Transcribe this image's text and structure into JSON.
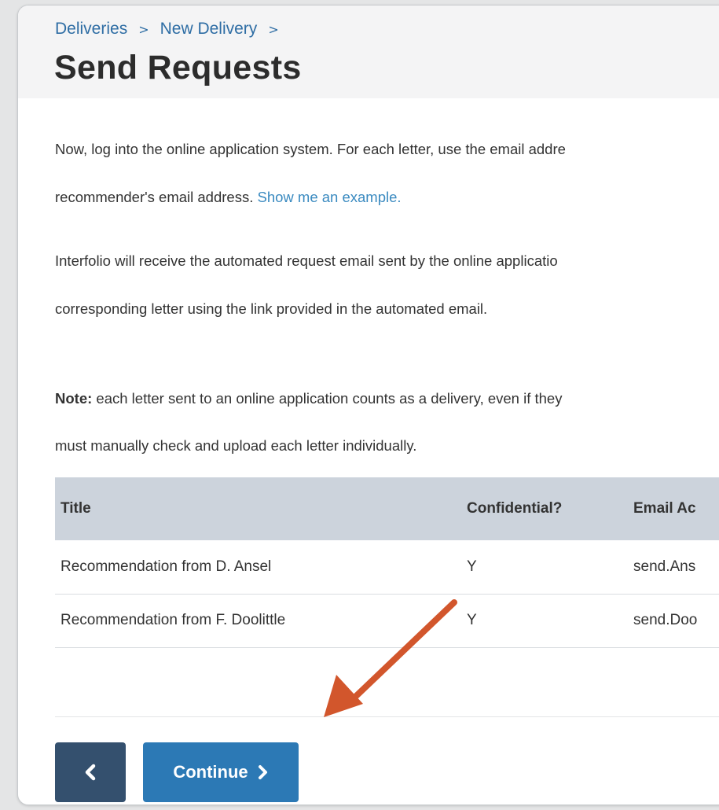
{
  "breadcrumb": {
    "items": [
      "Deliveries",
      "New Delivery"
    ],
    "separator": ">"
  },
  "page_title": "Send Requests",
  "instructions": {
    "p1_line1": "Now, log into the online application system. For each letter, use the email addre",
    "p1_line2_text": "recommender's email address. ",
    "p1_link": "Show me an example.",
    "p2_line1": "Interfolio will receive the automated request email sent by the online applicatio",
    "p2_line2": "corresponding letter using the link provided in the automated email.",
    "note_label": "Note:",
    "note_line1": " each letter sent to an online application counts as a delivery, even if they",
    "note_line2": "must manually check and upload each letter individually."
  },
  "table": {
    "columns": [
      "Title",
      "Confidential?",
      "Email Ac"
    ],
    "rows": [
      {
        "title": "Recommendation from D. Ansel",
        "confidential": "Y",
        "email": "send.Ans"
      },
      {
        "title": "Recommendation from F. Doolittle",
        "confidential": "Y",
        "email": "send.Doo"
      }
    ]
  },
  "buttons": {
    "back_icon": "chevron-left-icon",
    "continue_label": "Continue",
    "continue_icon": "chevron-right-icon"
  },
  "colors": {
    "link": "#2e6da4",
    "back_button": "#34506e",
    "continue_button": "#2c79b5",
    "table_header": "#ccd3dc",
    "annotation_arrow": "#d2562c"
  }
}
